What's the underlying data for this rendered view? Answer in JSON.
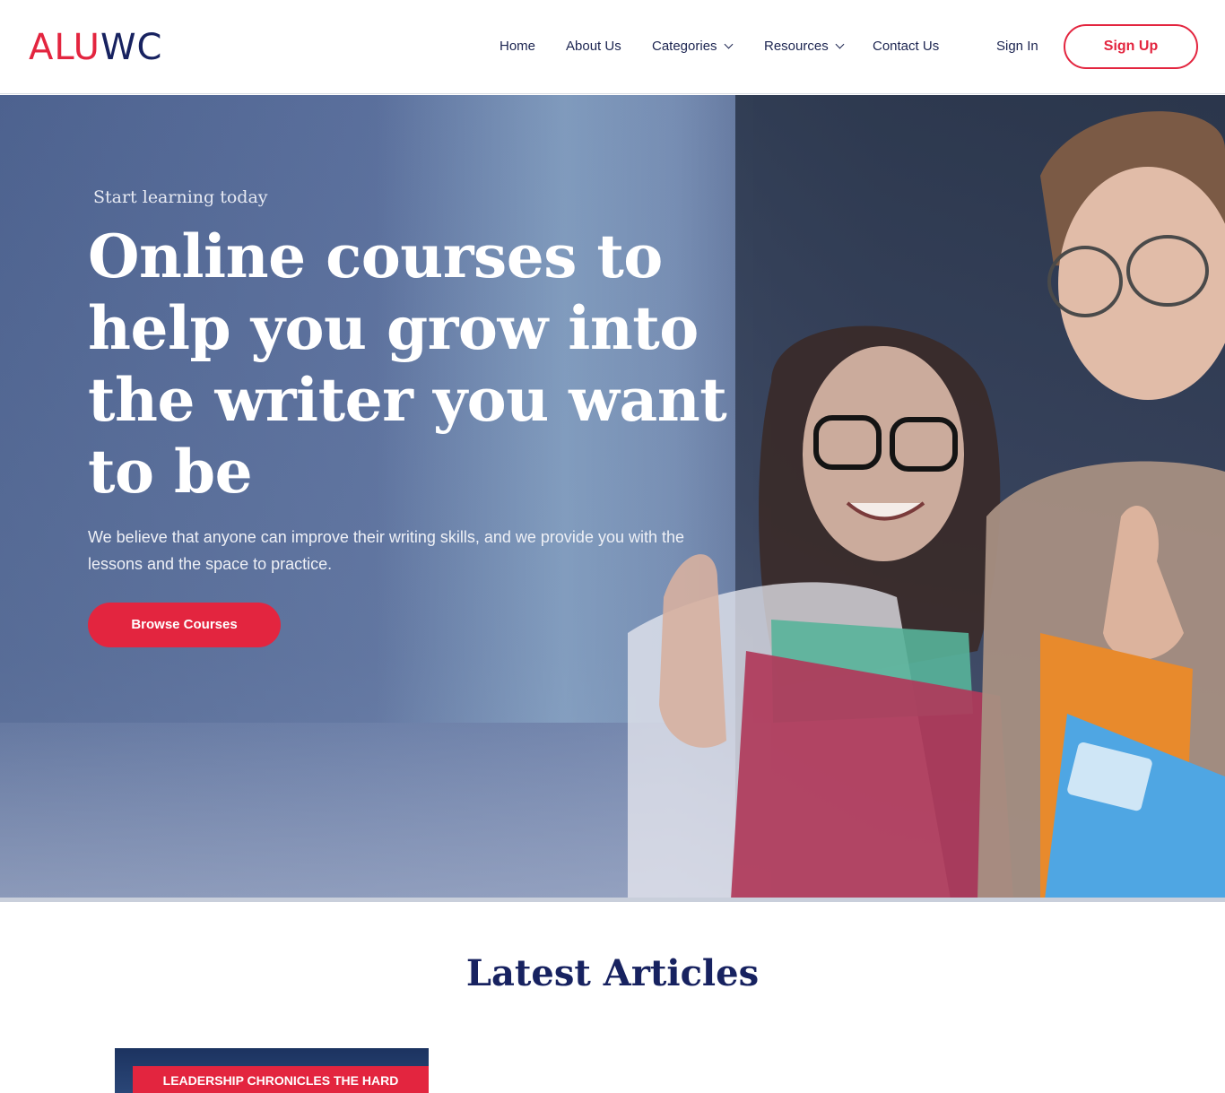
{
  "brand": {
    "logo_part1": "ALU",
    "logo_part2": "WC",
    "accent": "#e3253f",
    "navy": "#172260"
  },
  "nav": {
    "items": [
      {
        "label": "Home"
      },
      {
        "label": "About Us"
      },
      {
        "label": "Categories",
        "dropdown": true
      },
      {
        "label": "Resources",
        "dropdown": true
      },
      {
        "label": "Contact Us"
      }
    ],
    "sign_in": "Sign In",
    "sign_up": "Sign Up"
  },
  "hero": {
    "eyebrow": "Start learning today",
    "headline": "Online courses to help you grow into the writer you want to be",
    "subtext": "We believe that anyone can improve their writing skills, and we provide you with the lessons and the space to practice.",
    "cta": "Browse Courses"
  },
  "articles": {
    "heading": "Latest Articles",
    "cards": [
      {
        "tag": "LEADERSHIP CHRONICLES THE HARD"
      }
    ]
  },
  "icons": [
    "chevron-down-icon"
  ]
}
